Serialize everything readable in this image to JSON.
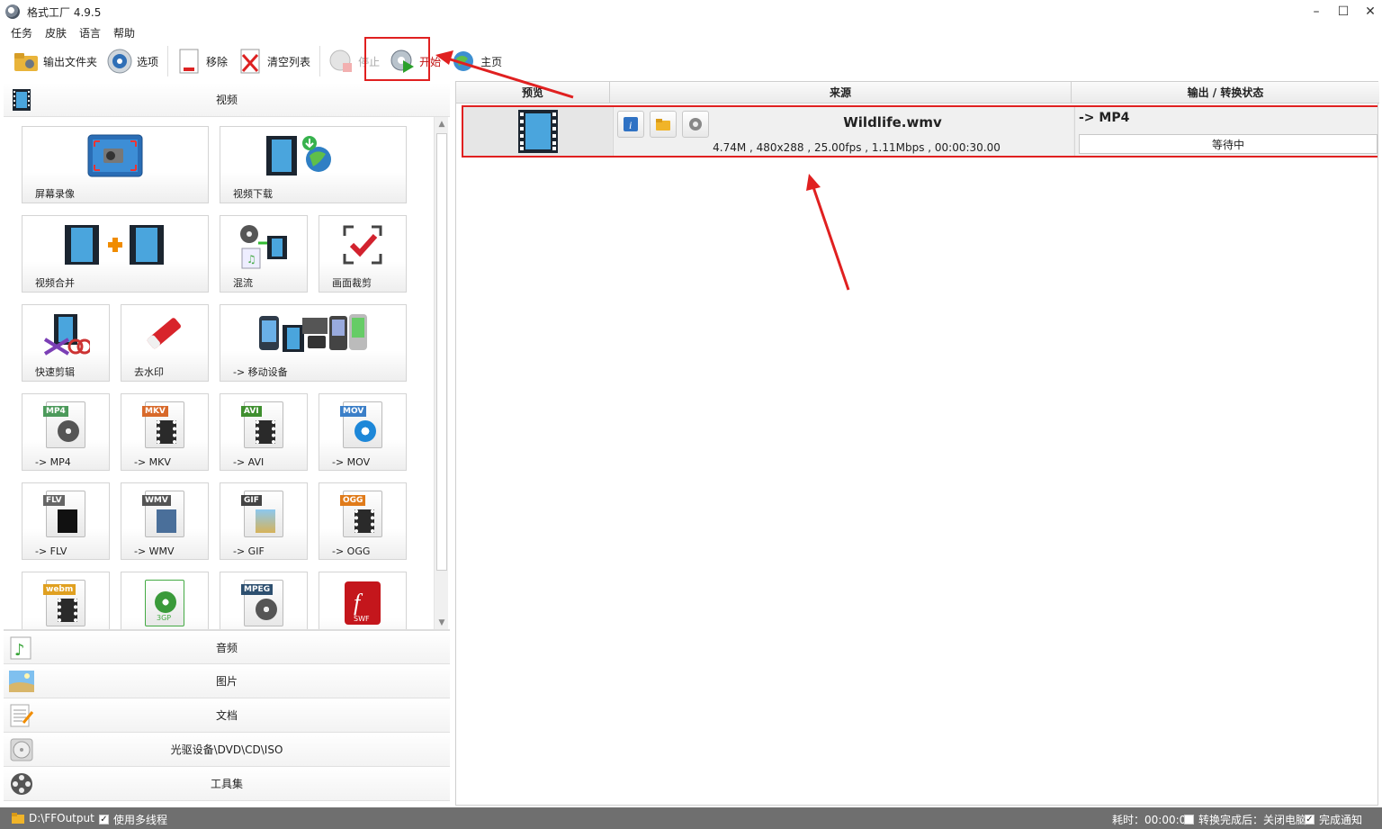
{
  "window": {
    "title": "格式工厂 4.9.5",
    "minimize": "–",
    "maximize": "☐",
    "close": "✕"
  },
  "menu": [
    "任务",
    "皮肤",
    "语言",
    "帮助"
  ],
  "toolbar": {
    "output_folder": "输出文件夹",
    "options": "选项",
    "remove": "移除",
    "clear_list": "清空列表",
    "stop": "停止",
    "start": "开始",
    "home": "主页"
  },
  "left": {
    "video_category": "视频",
    "tiles": [
      "屏幕录像",
      "视频下载",
      "视频合并",
      "混流",
      "画面裁剪",
      "快速剪辑",
      "去水印",
      "-> 移动设备",
      "-> MP4",
      "-> MKV",
      "-> AVI",
      "-> MOV",
      "-> FLV",
      "-> WMV",
      "-> GIF",
      "-> OGG"
    ],
    "file_tags": {
      "mp4": "MP4",
      "mkv": "MKV",
      "avi": "AVI",
      "mov": "MOV",
      "flv": "FLV",
      "wmv": "WMV",
      "gif": "GIF",
      "ogg": "OGG",
      "webm": "webm",
      "3gp": "3GP",
      "mpeg": "MPEG",
      "swf": "SWF"
    },
    "categories": [
      "音频",
      "图片",
      "文档",
      "光驱设备\\DVD\\CD\\ISO",
      "工具集"
    ]
  },
  "right": {
    "headers": {
      "preview": "预览",
      "source": "来源",
      "output": "输出 / 转换状态"
    },
    "task": {
      "filename": "Wildlife.wmv",
      "info": "4.74M , 480x288 , 25.00fps , 1.11Mbps , 00:00:30.00",
      "output_format": "-> MP4",
      "status": "等待中",
      "info_btn": "i"
    }
  },
  "statusbar": {
    "output_path": "D:\\FFOutput",
    "multithread": "使用多线程",
    "elapsed": "耗时：00:00:00",
    "after_complete": "转换完成后：关闭电脑",
    "notify": "完成通知"
  },
  "colors": {
    "highlight": "#e02020",
    "statusbar": "#6f6f6f"
  }
}
